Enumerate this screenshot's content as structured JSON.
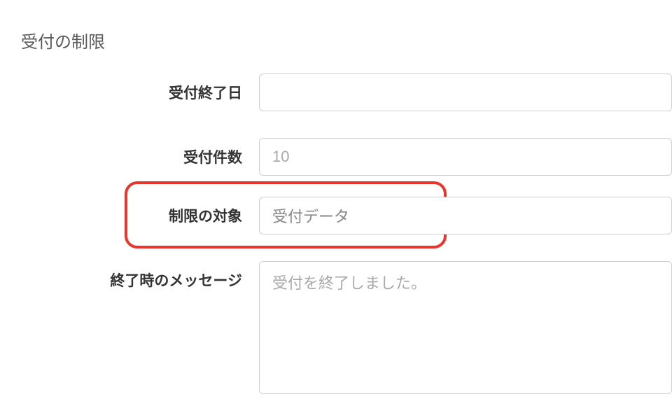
{
  "section": {
    "heading": "受付の制限"
  },
  "fields": {
    "end_date": {
      "label": "受付終了日",
      "value": ""
    },
    "count": {
      "label": "受付件数",
      "placeholder": "10",
      "value": ""
    },
    "target": {
      "label": "制限の対象",
      "value": "受付データ"
    },
    "end_message": {
      "label": "終了時のメッセージ",
      "placeholder": "受付を終了しました。",
      "value": ""
    }
  }
}
